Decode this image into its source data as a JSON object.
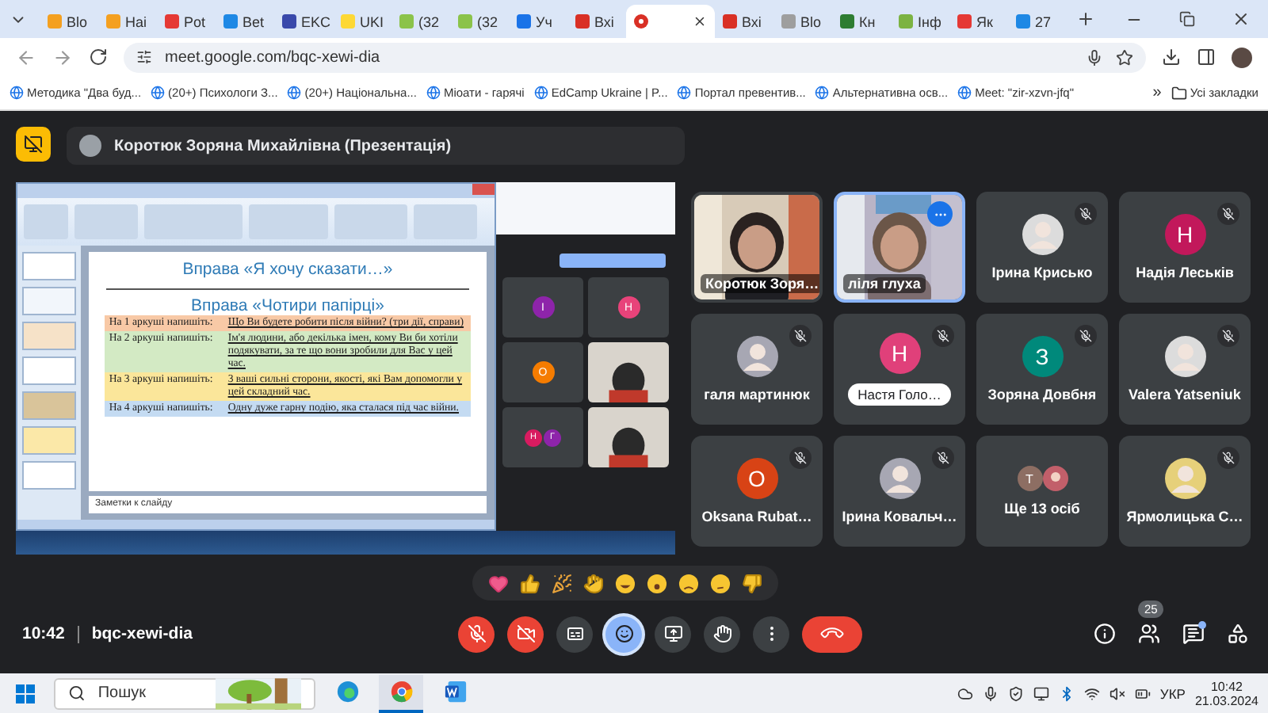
{
  "browser": {
    "tabs": [
      {
        "label": "Blo",
        "color": "#f4a020",
        "selected": false
      },
      {
        "label": "Наі",
        "color": "#f4a020",
        "selected": false
      },
      {
        "label": "Pot",
        "color": "#e53935",
        "selected": false
      },
      {
        "label": "Bet",
        "color": "#1e88e5",
        "selected": false
      },
      {
        "label": "EKC",
        "color": "#3949ab",
        "selected": false
      },
      {
        "label": "UKI",
        "color": "#fdd835",
        "selected": false
      },
      {
        "label": "(32",
        "color": "#8bc34a",
        "selected": false
      },
      {
        "label": "(32",
        "color": "#8bc34a",
        "selected": false
      },
      {
        "label": "Уч",
        "color": "#1a73e8",
        "selected": false
      },
      {
        "label": "Вхі",
        "color": "#d93025",
        "selected": false
      },
      {
        "color": "#d93025",
        "selected": true
      },
      {
        "label": "Вхі",
        "color": "#d93025",
        "selected": false
      },
      {
        "label": "Blo",
        "color": "#9e9e9e",
        "selected": false
      },
      {
        "label": "Кн",
        "color": "#2e7d32",
        "selected": false
      },
      {
        "label": "Інф",
        "color": "#7cb342",
        "selected": false
      },
      {
        "label": "Як",
        "color": "#e53935",
        "selected": false
      },
      {
        "label": "27",
        "color": "#1e88e5",
        "selected": false
      }
    ],
    "url": "meet.google.com/bqc-xewi-dia",
    "bookmarks": [
      {
        "label": "Методика \"Два буд..."
      },
      {
        "label": "(20+) Психологи З..."
      },
      {
        "label": "(20+) Національна..."
      },
      {
        "label": "Міоати - гарячі"
      },
      {
        "label": "EdCamp Ukraine | P..."
      },
      {
        "label": "Портал превентив..."
      },
      {
        "label": "Альтернативна осв..."
      },
      {
        "label": "Meet: \"zir-xzvn-jfq\""
      }
    ],
    "bookmarks_more": "»",
    "all_bookmarks": "Усі закладки"
  },
  "meet": {
    "presenter": "Коротюк Зоряна Михайлівна (Презентація)",
    "slide": {
      "title": "Вправа «Я хочу сказати…»",
      "subtitle": "Вправа «Чотири папірці»",
      "rows": [
        {
          "label": "На 1 аркуші напишіть:",
          "text": "Що Ви будете робити після війни? (три дії, справи)",
          "color": "#f8c9a6"
        },
        {
          "label": "На 2 аркуші напишіть:",
          "text": "Ім'я людини, або декілька імен, кому Ви би хотіли подякувати, за те що вони зробили для Вас у цей час.",
          "color": "#d3eac4"
        },
        {
          "label": "На 3 аркуші напишіть:",
          "text": "3 ваші сильні сторони, якості, які Вам допомогли у цей складний час.",
          "color": "#fbe69a"
        },
        {
          "label": "На 4 аркуші напишіть:",
          "text": "Одну дуже гарну подію, яка сталася під час війни.",
          "color": "#c4dbf2"
        }
      ],
      "notes": "Заметки к слайду"
    },
    "shared_tiles": [
      {
        "kind": "letter",
        "letter": "I",
        "color": "#8e24aa"
      },
      {
        "kind": "letter",
        "letter": "H",
        "color": "#e8437a"
      },
      {
        "kind": "letter",
        "letter": "O",
        "color": "#f57c00"
      },
      {
        "kind": "video"
      },
      {
        "kind": "pair",
        "avatars": [
          {
            "letter": "H",
            "color": "#d81b60"
          },
          {
            "letter": "Г",
            "color": "#8e24aa"
          }
        ]
      },
      {
        "kind": "video"
      }
    ],
    "tiles": [
      {
        "kind": "video",
        "name": "Коротюк Зоря…",
        "muted": false,
        "focused": false
      },
      {
        "kind": "video",
        "name": "ліля глуха",
        "muted": false,
        "focused": true
      },
      {
        "name": "Ірина Крисько",
        "muted": true,
        "focused": false
      },
      {
        "kind": "letter",
        "letter": "Н",
        "color": "#c2185b",
        "name": "Надія Леськів",
        "muted": true,
        "focused": false
      },
      {
        "name": "галя мартинюк",
        "muted": true,
        "focused": false
      },
      {
        "kind": "letter",
        "letter": "Н",
        "color": "#e0407a",
        "name": "Настя Голо…",
        "boxed": true,
        "muted": true,
        "focused": false
      },
      {
        "kind": "letter",
        "letter": "З",
        "color": "#00897b",
        "name": "Зоряна Довбня",
        "muted": true,
        "focused": false
      },
      {
        "name": "Valera Yatseniuk",
        "muted": true,
        "focused": false
      },
      {
        "kind": "letter",
        "letter": "O",
        "color": "#d84315",
        "name": "Oksana Rubat…",
        "muted": true,
        "focused": false
      },
      {
        "name": "Ірина Ковальч…",
        "muted": true,
        "focused": false
      },
      {
        "kind": "more",
        "letter": "T",
        "color": "#8d6e63",
        "name": "Ще 13 осіб",
        "muted": false,
        "focused": false
      },
      {
        "name": "Ярмолицька С…",
        "muted": true,
        "focused": false
      }
    ],
    "controls": [
      {
        "kind": "mic",
        "alert": true,
        "selected": false
      },
      {
        "kind": "camera",
        "alert": true,
        "selected": false
      },
      {
        "kind": "captions",
        "alert": false,
        "selected": false
      },
      {
        "kind": "reactions",
        "alert": false,
        "selected": true
      },
      {
        "kind": "present",
        "alert": false,
        "selected": false
      },
      {
        "kind": "hand",
        "alert": false,
        "selected": false
      },
      {
        "kind": "more",
        "alert": false,
        "selected": false
      },
      {
        "kind": "leave",
        "alert": true,
        "selected": false
      }
    ],
    "time": "10:42",
    "code": "bqc-xewi-dia",
    "people_count": "25",
    "chat_unread": true
  },
  "taskbar": {
    "search_placeholder": "Пошук",
    "apps": [
      {
        "kind": "edge",
        "selected": false
      },
      {
        "kind": "chrome",
        "selected": true
      },
      {
        "kind": "word",
        "selected": false
      }
    ],
    "language": "УКР",
    "time": "10:42",
    "date": "21.03.2024"
  }
}
